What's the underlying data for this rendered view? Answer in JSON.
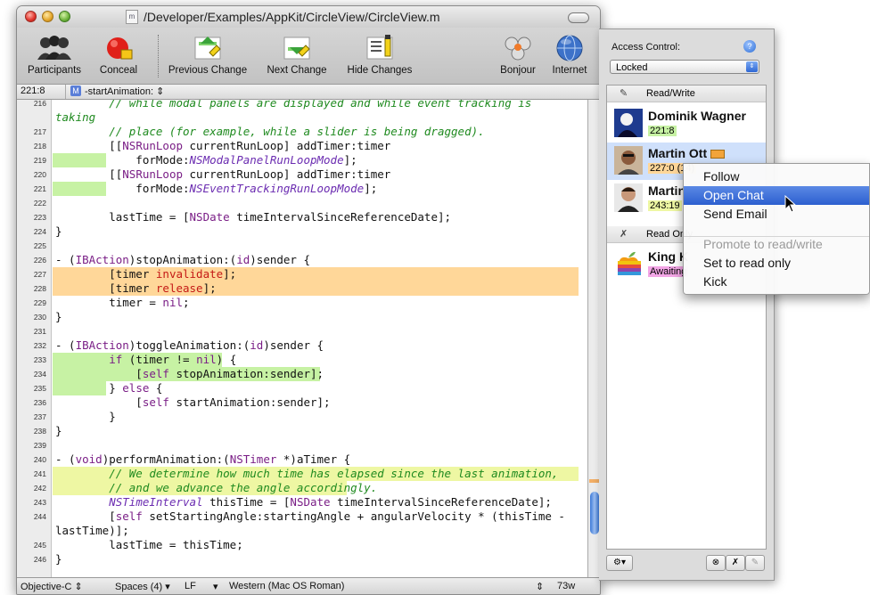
{
  "window": {
    "title": "/Developer/Examples/AppKit/CircleView/CircleView.m",
    "doc_icon": "m"
  },
  "toolbar": {
    "participants": "Participants",
    "conceal": "Conceal",
    "previous_change": "Previous Change",
    "next_change": "Next Change",
    "hide_changes": "Hide Changes",
    "bonjour": "Bonjour",
    "internet": "Internet"
  },
  "navbar": {
    "position": "221:8",
    "method_badge": "M",
    "function": "-startAnimation:",
    "popup_arrow": "⇕"
  },
  "code_lines": [
    {
      "n": "216",
      "t": "        // while modal panels are displayed and while event tracking is"
    },
    {
      "n": "",
      "t": "taking"
    },
    {
      "n": "217",
      "t": "        // place (for example, while a slider is being dragged)."
    },
    {
      "n": "218",
      "t": "        [[NSRunLoop currentRunLoop] addTimer:timer"
    },
    {
      "n": "219",
      "t": "            forMode:NSModalPanelRunLoopMode];"
    },
    {
      "n": "220",
      "t": "        [[NSRunLoop currentRunLoop] addTimer:timer"
    },
    {
      "n": "221",
      "t": "            forMode:NSEventTrackingRunLoopMode];"
    },
    {
      "n": "222",
      "t": ""
    },
    {
      "n": "223",
      "t": "        lastTime = [NSDate timeIntervalSinceReferenceDate];"
    },
    {
      "n": "224",
      "t": "}"
    },
    {
      "n": "225",
      "t": ""
    },
    {
      "n": "226",
      "t": "- (IBAction)stopAnimation:(id)sender {"
    },
    {
      "n": "227",
      "t": "        [timer invalidate];"
    },
    {
      "n": "228",
      "t": "        [timer release];"
    },
    {
      "n": "229",
      "t": "        timer = nil;"
    },
    {
      "n": "230",
      "t": "}"
    },
    {
      "n": "231",
      "t": ""
    },
    {
      "n": "232",
      "t": "- (IBAction)toggleAnimation:(id)sender {"
    },
    {
      "n": "233",
      "t": "        if (timer != nil) {"
    },
    {
      "n": "234",
      "t": "            [self stopAnimation:sender];"
    },
    {
      "n": "235",
      "t": "        } else {"
    },
    {
      "n": "236",
      "t": "            [self startAnimation:sender];"
    },
    {
      "n": "237",
      "t": "        }"
    },
    {
      "n": "238",
      "t": "}"
    },
    {
      "n": "239",
      "t": ""
    },
    {
      "n": "240",
      "t": "- (void)performAnimation:(NSTimer *)aTimer {"
    },
    {
      "n": "241",
      "t": "        // We determine how much time has elapsed since the last animation,"
    },
    {
      "n": "242",
      "t": "        // and we advance the angle accordingly."
    },
    {
      "n": "243",
      "t": "        NSTimeInterval thisTime = [NSDate timeIntervalSinceReferenceDate];"
    },
    {
      "n": "244",
      "t": "        [self setStartingAngle:startingAngle + angularVelocity * (thisTime -"
    },
    {
      "n": "",
      "t": "lastTime)];"
    },
    {
      "n": "245",
      "t": "        lastTime = thisTime;"
    },
    {
      "n": "246",
      "t": "}"
    }
  ],
  "statusbar": {
    "language": "Objective-C",
    "indent": "Spaces (4)",
    "line_ending": "LF",
    "encoding": "Western (Mac OS Roman)",
    "word_count": "73w"
  },
  "drawer": {
    "access_label": "Access Control:",
    "access_value": "Locked",
    "group_readwrite": "Read/Write",
    "group_readonly": "Read Only",
    "users": [
      {
        "name": "Dominik Wagner",
        "pos": "221:8",
        "pos_color": "#c7f2a4"
      },
      {
        "name": "Martin Ott",
        "pos": "227:0 (14)",
        "pos_color": "#ffd799"
      },
      {
        "name": "Martin",
        "pos": "243:19",
        "pos_color": "#eef7a3"
      },
      {
        "name": "King K",
        "pos": "Awaiting",
        "pos_color": "#f3a6e6"
      }
    ]
  },
  "context_menu": {
    "items": [
      "Follow",
      "Open Chat",
      "Send Email",
      "Promote to read/write",
      "Set to read only",
      "Kick"
    ]
  },
  "colors": {
    "change_green": "#c7f2a4",
    "change_orange": "#ffd799",
    "selection_blue": "#2c5fcf",
    "comment_green": "#1f8a1f"
  }
}
